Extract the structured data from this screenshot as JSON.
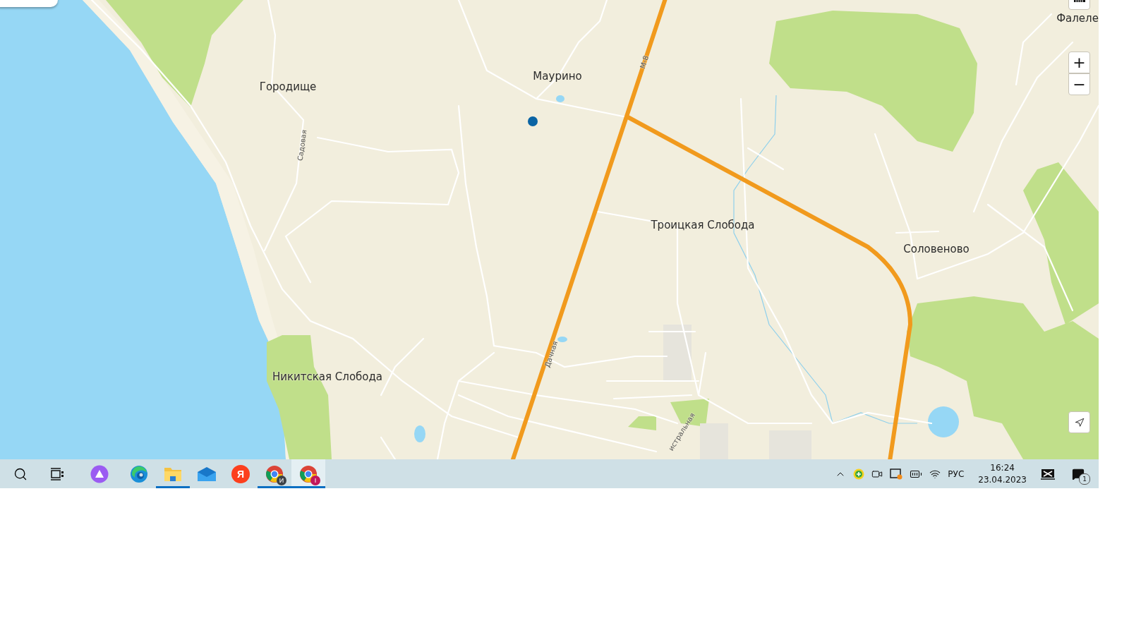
{
  "map": {
    "places": [
      {
        "name": "Городище",
        "kind": "place"
      },
      {
        "name": "Маурино",
        "kind": "place"
      },
      {
        "name": "Троицкая Слобода",
        "kind": "place"
      },
      {
        "name": "Соловеново",
        "kind": "place"
      },
      {
        "name": "Никитская Слобода",
        "kind": "place"
      },
      {
        "name": "Фалеле",
        "kind": "place"
      },
      {
        "name": "М-8",
        "kind": "road"
      },
      {
        "name": "Садовая",
        "kind": "road"
      },
      {
        "name": "Дачная",
        "kind": "road"
      },
      {
        "name": "истральная",
        "kind": "road"
      }
    ],
    "zoom_in": "+",
    "zoom_out": "−"
  },
  "taskbar": {
    "apps": [
      {
        "kind": "search",
        "running": false,
        "selected": false
      },
      {
        "kind": "taskview",
        "running": false,
        "selected": false
      },
      {
        "kind": "assistant",
        "running": false,
        "selected": false
      },
      {
        "kind": "edge",
        "running": false,
        "selected": false
      },
      {
        "kind": "folder",
        "running": true,
        "selected": false
      },
      {
        "kind": "mail",
        "running": false,
        "selected": false
      },
      {
        "kind": "yandex",
        "letter": "Я",
        "running": false,
        "selected": false
      },
      {
        "kind": "chrome",
        "badge": "И",
        "color": "#3c4248",
        "running": true,
        "selected": false
      },
      {
        "kind": "chrome",
        "badge": "I",
        "color": "#c2185b",
        "running": true,
        "selected": true
      }
    ],
    "tray": {
      "language": "РУС",
      "time": "16:24",
      "date": "23.04.2023",
      "notifications": "1"
    }
  }
}
